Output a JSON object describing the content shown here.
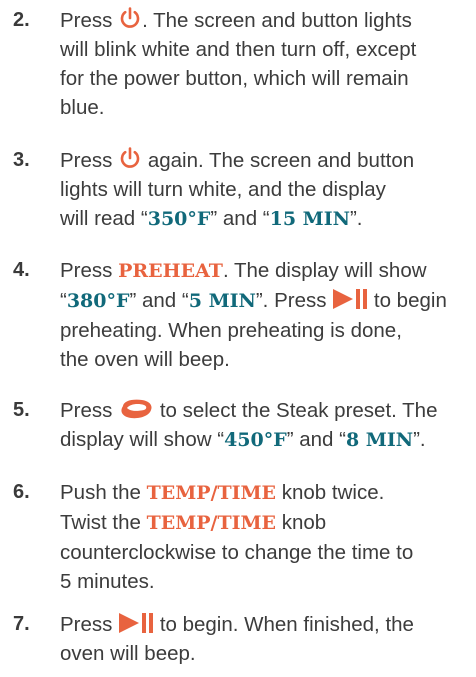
{
  "colors": {
    "accent_orange": "#e8633f",
    "value_teal": "#11697a",
    "text": "#3c3c3c"
  },
  "steps": [
    {
      "number": "2.",
      "line1a": "Press",
      "line1b": ". The screen and button lights",
      "line2": "will blink white and then turn off, except",
      "line3": "for the power button, which will remain",
      "line4": "blue."
    },
    {
      "number": "3.",
      "line1a": "Press",
      "line1b": "again. The screen and button",
      "line2": "lights will turn white, and the display",
      "line3a": "will read “",
      "val1": "350°F",
      "line3b": "” and “",
      "val2": "15 MIN",
      "line3c": "”."
    },
    {
      "number": "4.",
      "line1a": "Press",
      "mode": "PREHEAT",
      "line1b": ". The display will show",
      "line2a": "“",
      "val1": "380°F",
      "line2b": "” and “",
      "val2": "5 MIN",
      "line2c": "”. Press",
      "line2d": "to begin",
      "line3": "preheating. When preheating is done,",
      "line4": "the oven will beep."
    },
    {
      "number": "5.",
      "line1a": "Press",
      "line1b": "to select the Steak preset. The",
      "line2a": "display will show “",
      "val1": "450°F",
      "line2b": "” and “",
      "val2": "8 MIN",
      "line2c": "”."
    },
    {
      "number": "6.",
      "line1a": "Push the",
      "mode1": "TEMP/TIME",
      "line1b": "knob twice.",
      "line2a": "Twist the",
      "mode2": "TEMP/TIME",
      "line2b": "knob",
      "line3": "counterclockwise to change the time to",
      "line4": "5 minutes."
    },
    {
      "number": "7.",
      "line1a": "Press",
      "line1b": "to begin. When finished, the",
      "line2": "oven will beep."
    }
  ],
  "icons": {
    "power": "power-icon",
    "start_pause": "start-pause-icon",
    "steak": "steak-icon"
  }
}
